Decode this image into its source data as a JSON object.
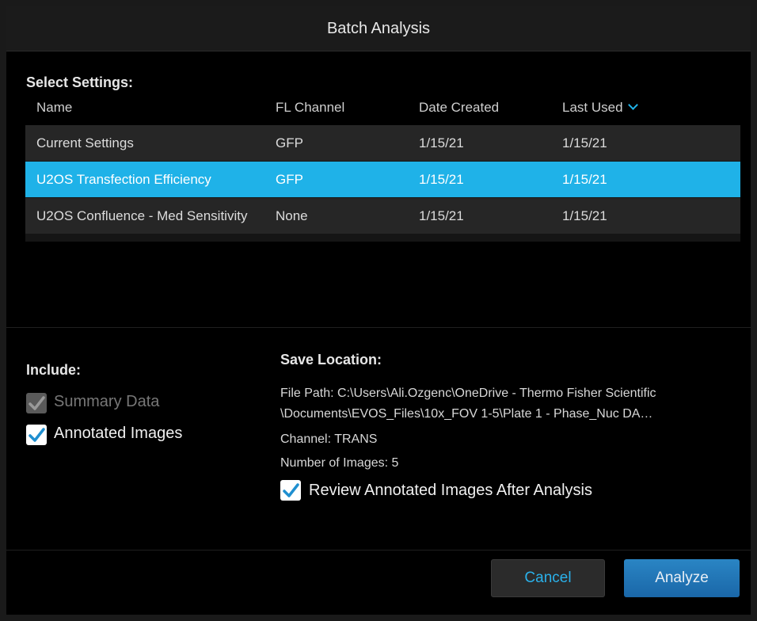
{
  "window": {
    "title": "Batch Analysis"
  },
  "settings": {
    "section_label": "Select Settings:",
    "columns": [
      "Name",
      "FL Channel",
      "Date Created",
      "Last Used"
    ],
    "rows": [
      {
        "name": "Current Settings",
        "channel": "GFP",
        "created": "1/15/21",
        "last_used": "1/15/21",
        "selected": false
      },
      {
        "name": "U2OS Transfection Efficiency",
        "channel": "GFP",
        "created": "1/15/21",
        "last_used": "1/15/21",
        "selected": true
      },
      {
        "name": "U2OS Confluence - Med Sensitivity",
        "channel": "None",
        "created": "1/15/21",
        "last_used": "1/15/21",
        "selected": false
      }
    ],
    "sort_icon": "chevron-down-icon"
  },
  "include": {
    "label": "Include:",
    "summary_data": {
      "label": "Summary Data",
      "checked": true,
      "enabled": false
    },
    "annotated_images": {
      "label": "Annotated Images",
      "checked": true,
      "enabled": true
    }
  },
  "save_location": {
    "label": "Save Location:",
    "file_path_line1": "File Path: C:\\Users\\Ali.Ozgenc\\OneDrive - Thermo Fisher Scientific",
    "file_path_line2": "\\Documents\\EVOS_Files\\10x_FOV 1-5\\Plate 1 - Phase_Nuc DA…",
    "channel": "Channel: TRANS",
    "num_images": "Number of Images: 5",
    "review": {
      "label": "Review Annotated Images After Analysis",
      "checked": true
    }
  },
  "buttons": {
    "cancel": "Cancel",
    "analyze": "Analyze"
  },
  "colors": {
    "accent": "#1fb2e8",
    "background": "#000000",
    "analyze": "#1a6fb0"
  }
}
